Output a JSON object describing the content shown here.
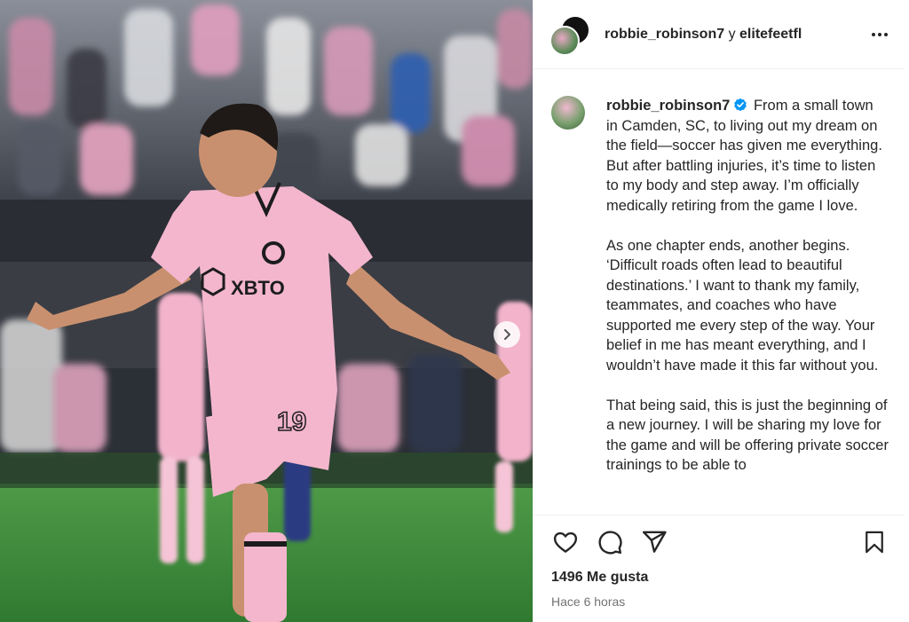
{
  "header": {
    "user1": "robbie_robinson7",
    "separator": "y",
    "user2": "elitefeetfl"
  },
  "caption": {
    "username": "robbie_robinson7",
    "paragraphs": [
      "From a small town in Camden, SC, to living out my dream on the field—soccer has given me everything. But after battling injuries, it’s time to listen to my body and step away. I’m officially medically retiring from the game I love.",
      "As one chapter ends, another begins. ‘Difficult roads often lead to beautiful destinations.’ I want to thank my family, teammates, and coaches who have supported me every step of the way. Your belief in me has meant everything, and I wouldn’t have made it this far without you.",
      "That being said, this is just the beginning of a new journey. I will be sharing my love for the game and will be offering private soccer trainings to be able to"
    ]
  },
  "photo": {
    "shirt_sponsor": "XBTO",
    "shirt_number": "19"
  },
  "stats": {
    "likes": "1496 Me gusta",
    "time": "Hace 6 horas"
  },
  "icons": {
    "like": "heart-icon",
    "comment": "comment-icon",
    "share": "paper-plane-icon",
    "save": "bookmark-icon",
    "more": "more-horizontal-icon",
    "next": "chevron-right-icon",
    "verified": "verified-badge-icon"
  },
  "colors": {
    "verified": "#0095f6",
    "jersey_pink": "#f3b6cd",
    "pitch_green": "#3f8a3c",
    "secondary_text": "#737373"
  }
}
